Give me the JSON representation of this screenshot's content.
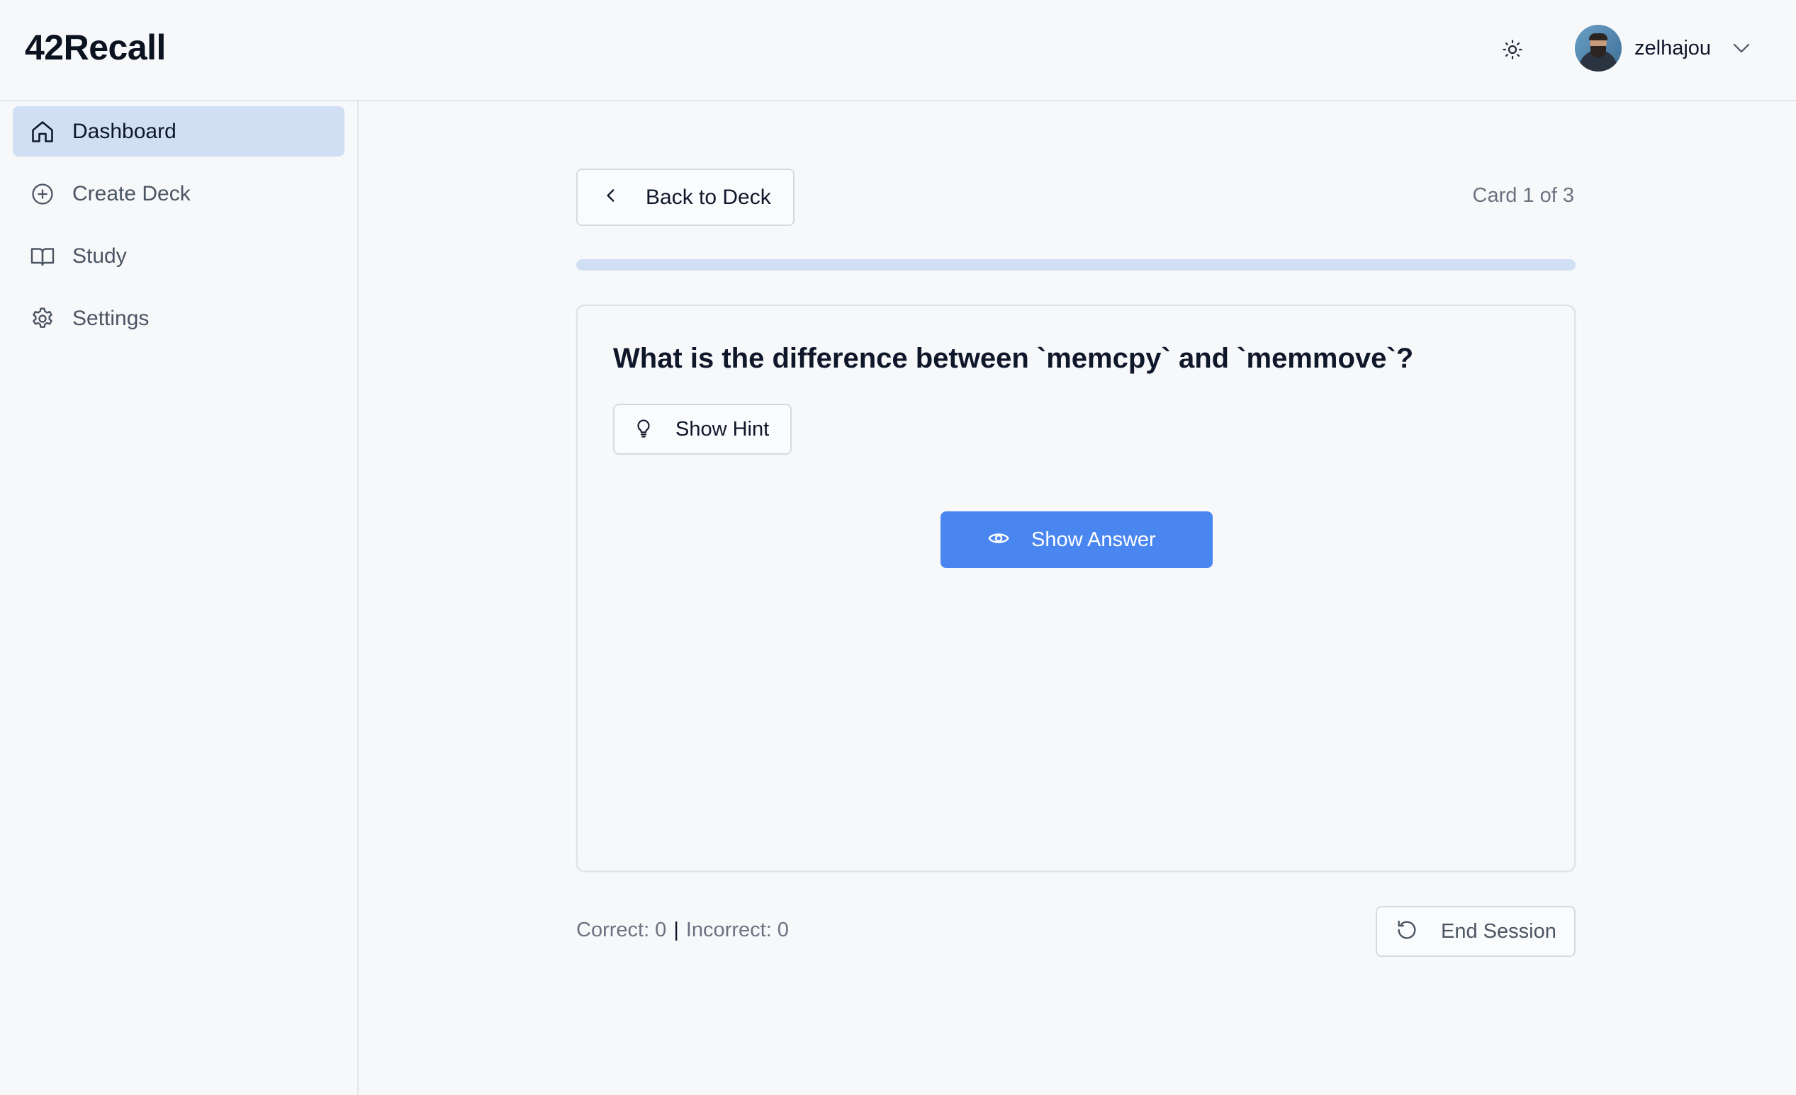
{
  "app": {
    "title": "42Recall"
  },
  "header": {
    "theme_icon": "sun-icon",
    "user": {
      "name": "zelhajou",
      "avatar_icon": "avatar"
    }
  },
  "sidebar": {
    "items": [
      {
        "label": "Dashboard",
        "icon": "home-icon",
        "active": true
      },
      {
        "label": "Create Deck",
        "icon": "plus-circle-icon",
        "active": false
      },
      {
        "label": "Study",
        "icon": "book-open-icon",
        "active": false
      },
      {
        "label": "Settings",
        "icon": "gear-icon",
        "active": false
      }
    ]
  },
  "study": {
    "back_label": "Back to Deck",
    "card_counter": "Card 1 of 3",
    "progress": 0,
    "question": "What is the difference between `memcpy` and `memmove`?",
    "hint_label": "Show Hint",
    "answer_label": "Show Answer",
    "stats": {
      "correct": "Correct: 0",
      "separator": "|",
      "incorrect": "Incorrect: 0"
    },
    "end_label": "End Session"
  },
  "colors": {
    "accent": "#4a86f0",
    "active_nav": "#d1dff5",
    "background": "#f7f8fa",
    "muted_text": "#6b7280"
  }
}
